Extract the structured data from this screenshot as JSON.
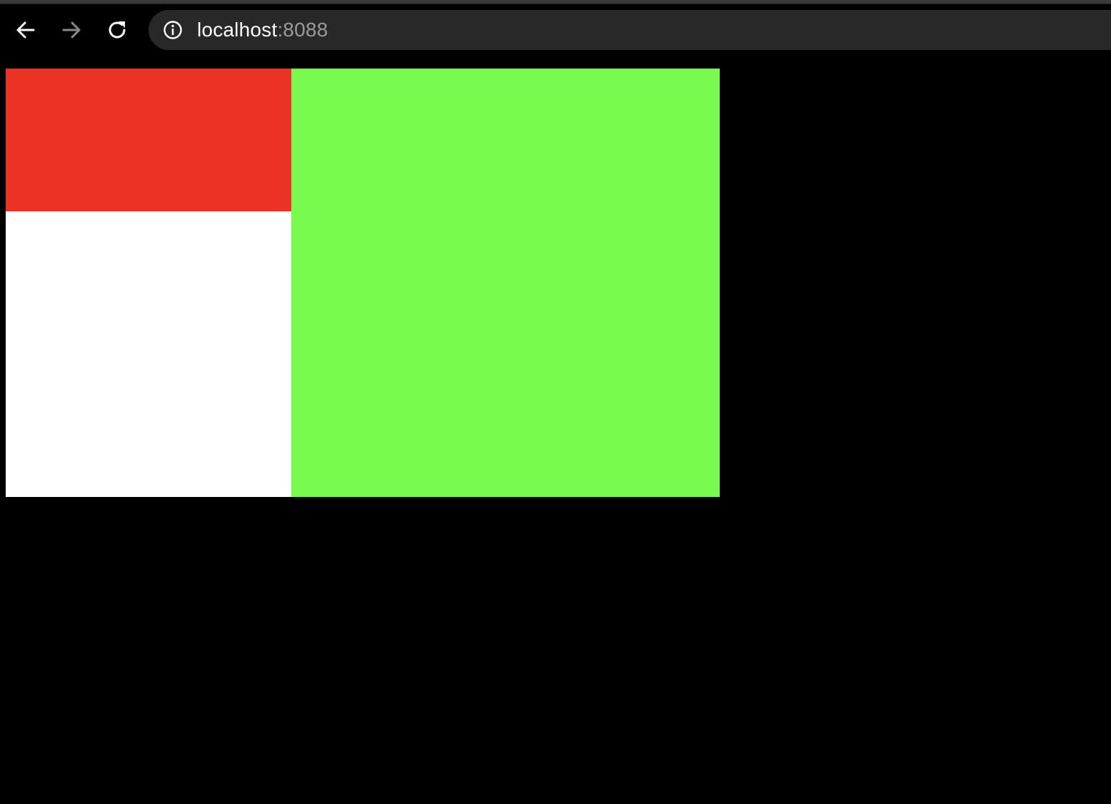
{
  "browser": {
    "url_host": "localhost",
    "url_port": ":8088",
    "icons": {
      "back": "back-arrow-icon",
      "forward": "forward-arrow-icon",
      "reload": "reload-icon",
      "site_info": "info-icon"
    }
  },
  "page": {
    "background": "#000000",
    "blocks": [
      {
        "name": "red-block",
        "color": "#ec3323"
      },
      {
        "name": "white-block",
        "color": "#ffffff"
      },
      {
        "name": "green-block",
        "color": "#78fa50"
      }
    ]
  }
}
